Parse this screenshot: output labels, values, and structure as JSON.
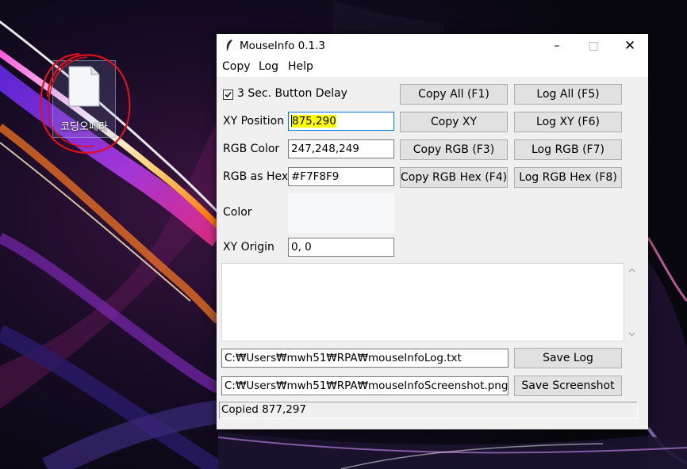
{
  "desktop": {
    "icon_label": "코딩오페라",
    "icon_name": "document-file-icon",
    "annotation_color": "#e0101a"
  },
  "window": {
    "title": "MouseInfo 0.1.3",
    "controls": {
      "minimize": "–",
      "maximize": "□",
      "close": "✕"
    }
  },
  "menu": [
    "Copy",
    "Log",
    "Help"
  ],
  "delay_checkbox": {
    "label": "3 Sec. Button Delay",
    "checked": true
  },
  "fields": {
    "xy_position": {
      "label": "XY Position",
      "value": "875,290",
      "highlight_color": "#ffff00"
    },
    "rgb_color": {
      "label": "RGB Color",
      "value": "247,248,249"
    },
    "rgb_hex": {
      "label": "RGB as Hex",
      "value": "#F7F8F9"
    },
    "color": {
      "label": "Color",
      "swatch": "#F7F8F9"
    },
    "xy_origin": {
      "label": "XY Origin",
      "value": "0, 0"
    }
  },
  "buttons": {
    "copy_all": "Copy All (F1)",
    "log_all": "Log All (F5)",
    "copy_xy": "Copy XY",
    "log_xy": "Log XY (F6)",
    "copy_rgb": "Copy RGB (F3)",
    "log_rgb": "Log RGB (F7)",
    "copy_rgb_hex": "Copy RGB Hex (F4)",
    "log_rgb_hex": "Log RGB Hex (F8)",
    "save_log": "Save Log",
    "save_screenshot": "Save Screenshot"
  },
  "paths": {
    "log_file": "C:₩Users₩mwh51₩RPA₩mouseInfoLog.txt",
    "screenshot_file": "C:₩Users₩mwh51₩RPA₩mouseInfoScreenshot.png"
  },
  "status": "Copied 877,297"
}
